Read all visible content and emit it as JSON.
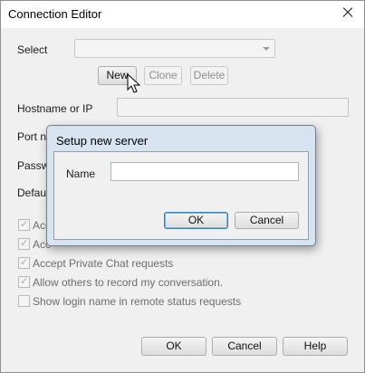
{
  "window": {
    "title": "Connection Editor"
  },
  "select": {
    "label": "Select",
    "value": ""
  },
  "toolbar": {
    "new_label": "New",
    "clone_label": "Clone",
    "delete_label": "Delete"
  },
  "fields": {
    "hostname_label": "Hostname or IP",
    "hostname_value": "",
    "port_label": "Port nu",
    "password_label": "Passwo",
    "default_label": "Default"
  },
  "checkboxes": [
    {
      "label": "Acc",
      "checked": true
    },
    {
      "label": "Acc",
      "checked": true
    },
    {
      "label": "Accept Private Chat requests",
      "checked": true
    },
    {
      "label": "Allow others to record my conversation.",
      "checked": true
    },
    {
      "label": "Show login name in remote status requests",
      "checked": false
    }
  ],
  "footer": {
    "ok_label": "OK",
    "cancel_label": "Cancel",
    "help_label": "Help"
  },
  "dialog": {
    "title": "Setup new server",
    "name_label": "Name",
    "name_value": "",
    "ok_label": "OK",
    "cancel_label": "Cancel"
  }
}
